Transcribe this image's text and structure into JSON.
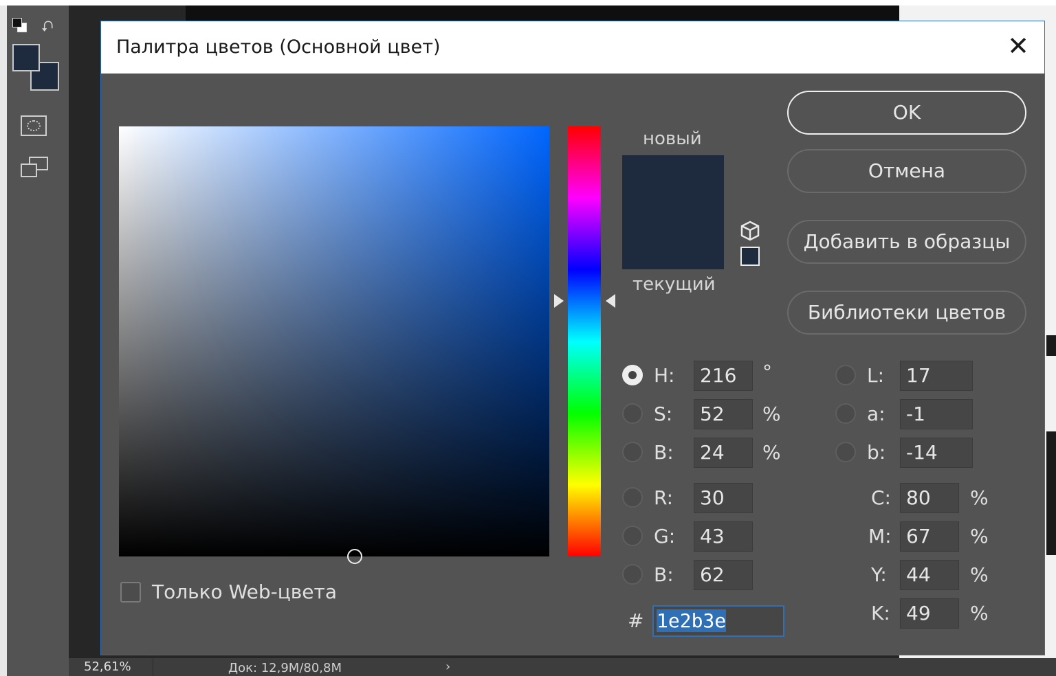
{
  "dialog": {
    "title": "Палитра цветов (Основной цвет)",
    "close_label": "✕"
  },
  "preview": {
    "new_label": "новый",
    "current_label": "текущий",
    "color": "#1e2b3e"
  },
  "buttons": {
    "ok": "OK",
    "cancel": "Отмена",
    "add_to_swatches": "Добавить в образцы",
    "color_libraries": "Библиотеки цветов"
  },
  "fields": {
    "hsb": [
      {
        "label": "H:",
        "value": "216",
        "unit": "°",
        "selected": true
      },
      {
        "label": "S:",
        "value": "52",
        "unit": "%",
        "selected": false
      },
      {
        "label": "B:",
        "value": "24",
        "unit": "%",
        "selected": false
      }
    ],
    "rgb": [
      {
        "label": "R:",
        "value": "30"
      },
      {
        "label": "G:",
        "value": "43"
      },
      {
        "label": "B:",
        "value": "62"
      }
    ],
    "lab": [
      {
        "label": "L:",
        "value": "17"
      },
      {
        "label": "a:",
        "value": "-1"
      },
      {
        "label": "b:",
        "value": "-14"
      }
    ],
    "cmyk": [
      {
        "label": "C:",
        "value": "80",
        "unit": "%"
      },
      {
        "label": "M:",
        "value": "67",
        "unit": "%"
      },
      {
        "label": "Y:",
        "value": "44",
        "unit": "%"
      },
      {
        "label": "K:",
        "value": "49",
        "unit": "%"
      }
    ],
    "hex_label": "#",
    "hex_value": "1e2b3e"
  },
  "web_only": {
    "label": "Только Web-цвета",
    "checked": false
  },
  "statusbar": {
    "zoom": "52,61%",
    "doc": "Док: 12,9M/80,8M",
    "arrow": "›"
  },
  "colors": {
    "accent": "#2f6fb6",
    "dialog_bg": "#535353"
  }
}
